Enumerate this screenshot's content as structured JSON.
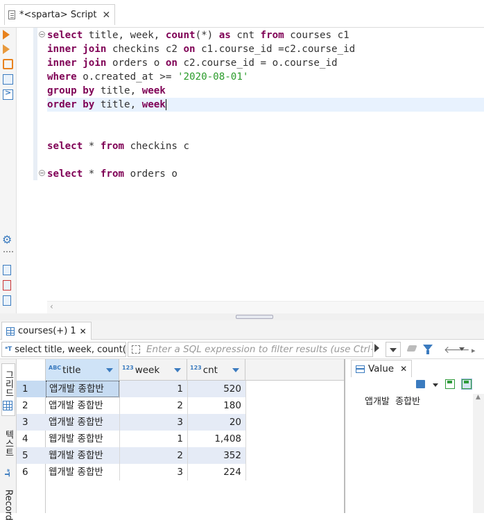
{
  "editor": {
    "tab_title": "*<sparta> Script",
    "tab_close": "✕",
    "lines": [
      {
        "parts": [
          {
            "t": "select",
            "c": "kw"
          },
          {
            "t": " title, week, "
          },
          {
            "t": "count",
            "c": "kw"
          },
          {
            "t": "(*) "
          },
          {
            "t": "as",
            "c": "kw"
          },
          {
            "t": " cnt "
          },
          {
            "t": "from",
            "c": "kw"
          },
          {
            "t": " courses c1"
          }
        ]
      },
      {
        "parts": [
          {
            "t": "inner join",
            "c": "kw"
          },
          {
            "t": " checkins c2 "
          },
          {
            "t": "on",
            "c": "kw"
          },
          {
            "t": " c1.course_id =c2.course_id"
          }
        ]
      },
      {
        "parts": [
          {
            "t": "inner join",
            "c": "kw"
          },
          {
            "t": " orders o "
          },
          {
            "t": "on",
            "c": "kw"
          },
          {
            "t": " c2.course_id = o.course_id"
          }
        ]
      },
      {
        "parts": [
          {
            "t": "where",
            "c": "kw"
          },
          {
            "t": " o.created_at >= "
          },
          {
            "t": "'2020-08-01'",
            "c": "str"
          }
        ]
      },
      {
        "parts": [
          {
            "t": "group by",
            "c": "kw"
          },
          {
            "t": " title, "
          },
          {
            "t": "week",
            "c": "kw"
          }
        ]
      },
      {
        "parts": [
          {
            "t": "order by",
            "c": "kw"
          },
          {
            "t": " title, "
          },
          {
            "t": "week",
            "c": "kw"
          }
        ],
        "caret": true
      },
      {
        "parts": []
      },
      {
        "parts": []
      },
      {
        "parts": [
          {
            "t": "select",
            "c": "kw"
          },
          {
            "t": " * "
          },
          {
            "t": "from",
            "c": "kw"
          },
          {
            "t": " checkins c"
          }
        ]
      },
      {
        "parts": []
      },
      {
        "parts": [
          {
            "t": "select",
            "c": "kw"
          },
          {
            "t": " * "
          },
          {
            "t": "from",
            "c": "kw"
          },
          {
            "t": " orders o"
          }
        ]
      }
    ],
    "hscroll_left": "‹"
  },
  "results": {
    "tab_label": "courses(+) 1",
    "tab_close": "✕",
    "query_text": "select title, week, count(*) as cnt",
    "filter_placeholder": "Enter a SQL expression to filter results (use Ctrl+Space)",
    "side_tabs": {
      "grid": "그리드",
      "text": "텍스트",
      "record": "Record"
    },
    "columns": [
      {
        "badge": "ABC",
        "label": "title"
      },
      {
        "badge": "123",
        "label": "week"
      },
      {
        "badge": "123",
        "label": "cnt"
      }
    ],
    "rows": [
      {
        "num": "1",
        "title": "앱개발 종합반",
        "week": "1",
        "cnt": "520"
      },
      {
        "num": "2",
        "title": "앱개발 종합반",
        "week": "2",
        "cnt": "180"
      },
      {
        "num": "3",
        "title": "앱개발 종합반",
        "week": "3",
        "cnt": "20"
      },
      {
        "num": "4",
        "title": "웹개발 종합반",
        "week": "1",
        "cnt": "1,408"
      },
      {
        "num": "5",
        "title": "웹개발 종합반",
        "week": "2",
        "cnt": "352"
      },
      {
        "num": "6",
        "title": "웹개발 종합반",
        "week": "3",
        "cnt": "224"
      }
    ]
  },
  "value_panel": {
    "tab_label": "Value",
    "tab_close": "✕",
    "content": "앱개발  종합반"
  }
}
